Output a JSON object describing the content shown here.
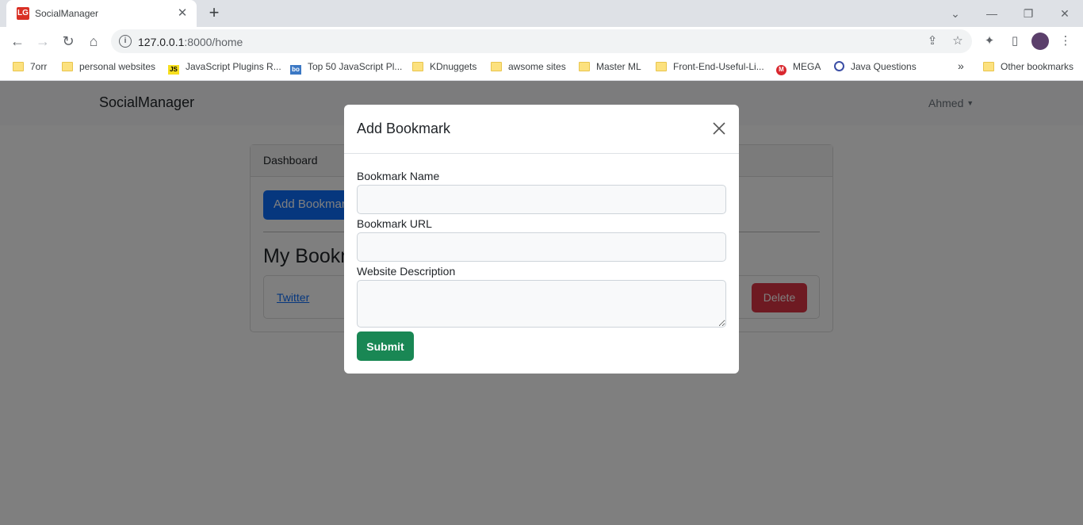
{
  "browser": {
    "tab_title": "SocialManager",
    "tab_favicon_text": "LG",
    "url_host": "127.0.0.1",
    "url_rest": ":8000/home",
    "bookmarks": [
      {
        "label": "7orr",
        "icon": "folder-icon"
      },
      {
        "label": "personal websites",
        "icon": "folder-icon"
      },
      {
        "label": "JavaScript Plugins R...",
        "icon": "js-icon"
      },
      {
        "label": "Top 50 JavaScript Pl...",
        "icon": "bo-icon"
      },
      {
        "label": "KDnuggets",
        "icon": "folder-icon"
      },
      {
        "label": "awsome sites",
        "icon": "folder-icon"
      },
      {
        "label": "Master ML",
        "icon": "folder-icon"
      },
      {
        "label": "Front-End-Useful-Li...",
        "icon": "folder-icon"
      },
      {
        "label": "MEGA",
        "icon": "mega-icon"
      },
      {
        "label": "Java Questions",
        "icon": "q-icon"
      }
    ],
    "more_chevron": "»",
    "other_bookmarks": "Other bookmarks"
  },
  "navbar": {
    "brand": "SocialManager",
    "user": "Ahmed"
  },
  "dashboard": {
    "header": "Dashboard",
    "add_button": "Add Bookmark",
    "section_title": "My Bookmarks",
    "bookmarks": [
      {
        "name": "Twitter",
        "delete_label": "Delete"
      }
    ]
  },
  "modal": {
    "title": "Add Bookmark",
    "fields": {
      "name_label": "Bookmark Name",
      "name_value": "",
      "url_label": "Bookmark URL",
      "url_value": "",
      "description_label": "Website Description",
      "description_value": ""
    },
    "submit_label": "Submit"
  },
  "colors": {
    "primary": "#0d6efd",
    "danger": "#dc3545",
    "success": "#198754",
    "backdrop": "rgba(0,0,0,0.5)"
  }
}
